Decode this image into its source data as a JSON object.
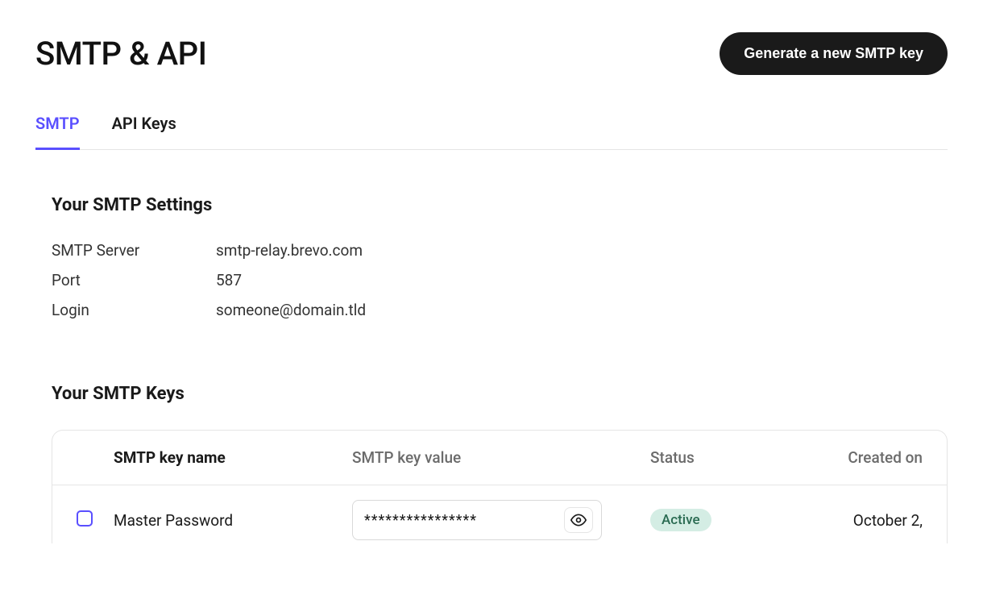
{
  "header": {
    "title": "SMTP & API",
    "generate_button_label": "Generate a new SMTP key"
  },
  "tabs": [
    {
      "label": "SMTP",
      "active": true
    },
    {
      "label": "API Keys",
      "active": false
    }
  ],
  "smtp_settings": {
    "heading": "Your SMTP Settings",
    "rows": [
      {
        "label": "SMTP Server",
        "value": "smtp-relay.brevo.com"
      },
      {
        "label": "Port",
        "value": "587"
      },
      {
        "label": "Login",
        "value": "someone@domain.tld"
      }
    ]
  },
  "smtp_keys": {
    "heading": "Your SMTP Keys",
    "columns": {
      "name": "SMTP key name",
      "value": "SMTP key value",
      "status": "Status",
      "created": "Created on"
    },
    "rows": [
      {
        "name": "Master Password",
        "masked_value": "****************",
        "status": "Active",
        "created_on": "October 2,"
      }
    ]
  }
}
